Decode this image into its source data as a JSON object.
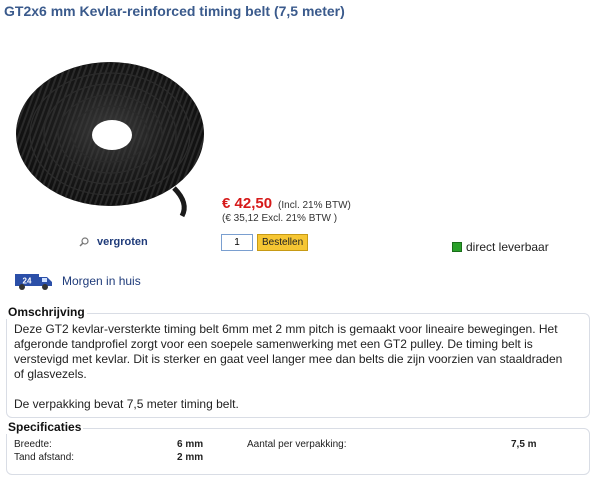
{
  "product": {
    "title": "GT2x6 mm Kevlar-reinforced timing belt (7,5 meter)",
    "zoom_label": "vergroten"
  },
  "pricing": {
    "price": "€ 42,50",
    "incl": "(Incl. 21% BTW)",
    "excl": "(€ 35,12 Excl. 21% BTW )"
  },
  "order": {
    "quantity": "1",
    "button_label": "Bestellen"
  },
  "stock": {
    "label": "direct leverbaar",
    "color": "#2aa02a"
  },
  "delivery": {
    "badge": "24",
    "label": "Morgen in huis"
  },
  "description": {
    "heading": "Omschrijving",
    "paragraph1": "Deze GT2 kevlar-versterkte timing belt 6mm met 2 mm pitch is gemaakt voor lineaire bewegingen. Het afgeronde tandprofiel zorgt voor een soepele samenwerking met een GT2 pulley. De timing belt is verstevigd met kevlar. Dit is sterker en gaat veel langer mee dan belts die zijn voorzien van staaldraden of glasvezels.",
    "paragraph2": "De verpakking bevat 7,5 meter timing belt."
  },
  "specs": {
    "heading": "Specificaties",
    "rows": [
      {
        "label": "Breedte:",
        "value": "6 mm",
        "label2": "Aantal per verpakking:",
        "value2": "7,5 m"
      },
      {
        "label": "Tand afstand:",
        "value": "2 mm",
        "label2": "",
        "value2": ""
      }
    ]
  },
  "colors": {
    "title": "#3a5a8c",
    "price": "#d61a1a",
    "button": "#f6c633",
    "link": "#1f3b7a"
  }
}
